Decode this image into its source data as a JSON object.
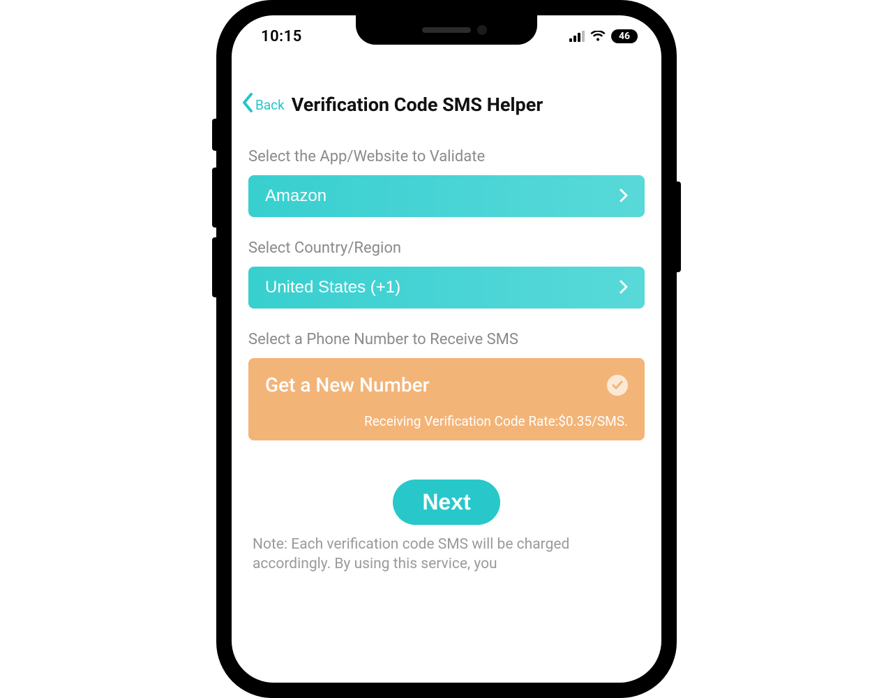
{
  "status": {
    "time": "10:15",
    "battery": "46"
  },
  "nav": {
    "back": "Back",
    "title": "Verification Code SMS Helper"
  },
  "sections": {
    "app": {
      "label": "Select the App/Website to Validate",
      "value": "Amazon"
    },
    "country": {
      "label": "Select Country/Region",
      "value": "United States (+1)"
    },
    "phone": {
      "label": "Select a Phone Number to Receive SMS",
      "option_title": "Get a New Number",
      "option_sub": "Receiving Verification Code Rate:$0.35/SMS."
    }
  },
  "next_label": "Next",
  "note": "Note: Each verification code SMS will be charged accordingly. By using this service, you"
}
